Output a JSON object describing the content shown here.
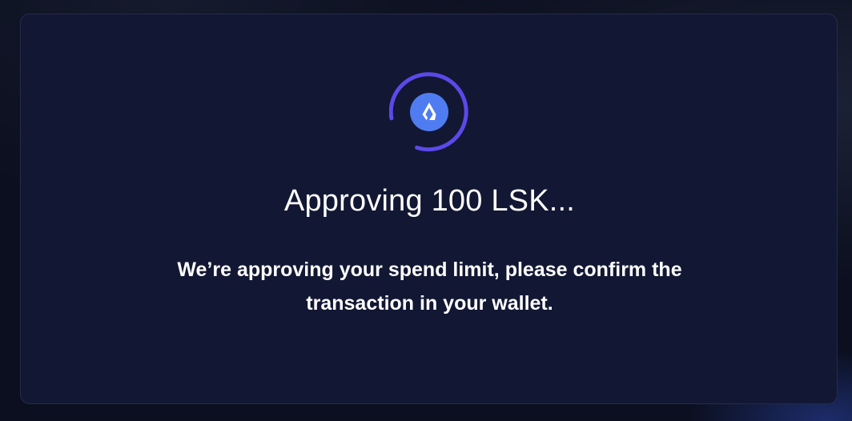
{
  "modal": {
    "title": "Approving 100 LSK...",
    "description": "We’re approving your spend limit, please confirm the transaction in your wallet."
  },
  "spinner": {
    "icon": "lisk-token-icon",
    "colors": {
      "arc": "#5b49e8",
      "token_bg": "#4f7cf0",
      "token_glyph": "#ffffff"
    }
  },
  "colors": {
    "page_bg": "#0b0f1f",
    "modal_bg": "#121733",
    "text": "#ffffff"
  }
}
